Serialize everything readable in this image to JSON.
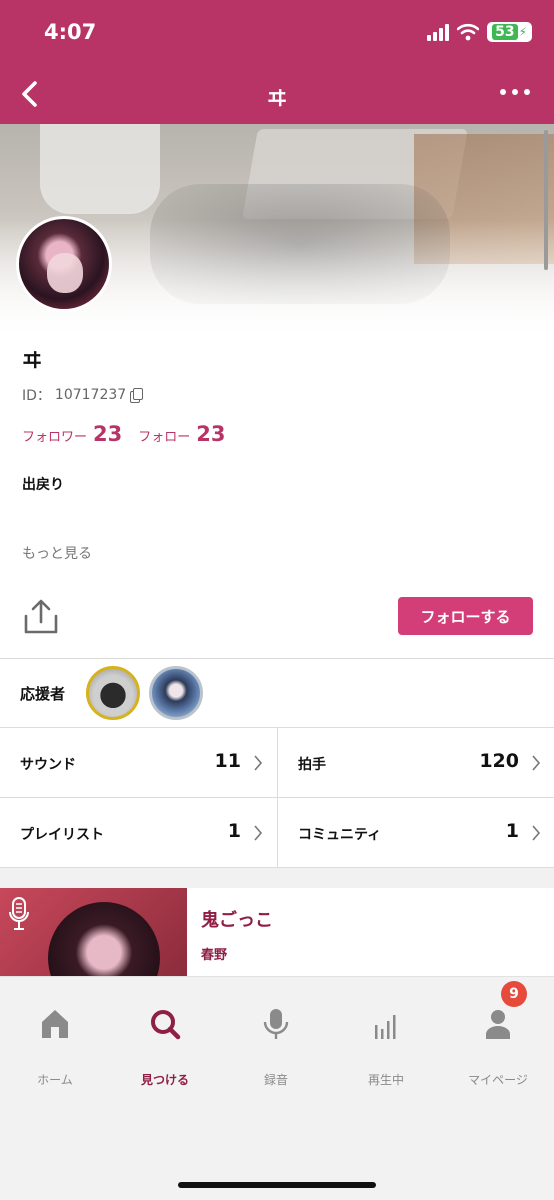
{
  "status_bar": {
    "time": "4:07",
    "battery": "53"
  },
  "nav": {
    "title": "ヰ"
  },
  "profile": {
    "name": "ヰ",
    "id_label": "ID：",
    "id_value": "10717237",
    "followers_label": "フォロワー",
    "followers_count": "23",
    "following_label": "フォロー",
    "following_count": "23",
    "bio": "出戻り",
    "more_link": "もっと見る"
  },
  "actions": {
    "follow_label": "フォローする"
  },
  "supporters": {
    "label": "応援者"
  },
  "stats": [
    {
      "label": "サウンド",
      "value": "11"
    },
    {
      "label": "拍手",
      "value": "120"
    },
    {
      "label": "プレイリスト",
      "value": "1"
    },
    {
      "label": "コミュニティ",
      "value": "1"
    }
  ],
  "track": {
    "title": "鬼ごっこ",
    "artist": "春野"
  },
  "tabs": [
    {
      "label": "ホーム",
      "icon": "home-icon"
    },
    {
      "label": "見つける",
      "icon": "search-icon",
      "active": true
    },
    {
      "label": "録音",
      "icon": "mic-icon"
    },
    {
      "label": "再生中",
      "icon": "bars-icon"
    },
    {
      "label": "マイページ",
      "icon": "person-icon",
      "badge": "9"
    }
  ],
  "colors": {
    "header": "#b83466",
    "accent": "#d43e78",
    "track_text": "#8f1f44",
    "badge": "#e64a3b"
  }
}
